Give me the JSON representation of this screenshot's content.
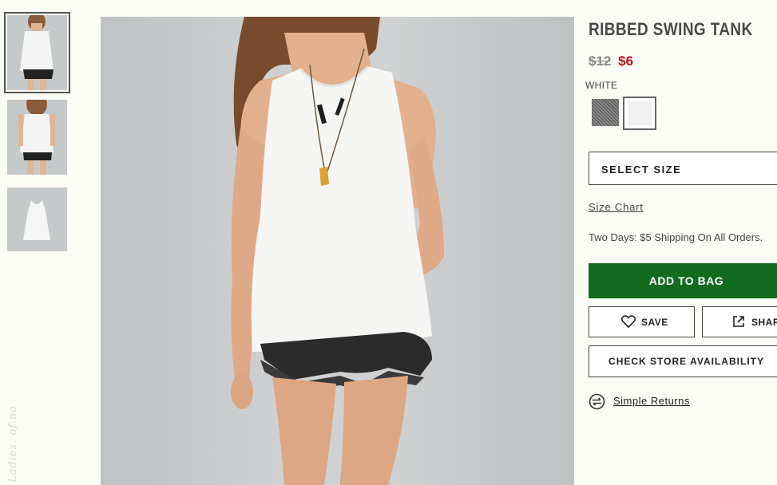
{
  "product": {
    "title": "RIBBED SWING TANK",
    "original_price": "$12",
    "sale_price": "$6",
    "color_name": "WHITE",
    "swatches": [
      "grey-heather",
      "white"
    ],
    "selected_swatch": "white"
  },
  "actions": {
    "size_select_label": "SELECT SIZE",
    "size_chart_label": "Size Chart",
    "shipping_text": "Two Days: $5 Shipping On All Orders.",
    "add_to_bag_label": "ADD TO BAG",
    "save_label": "SAVE",
    "share_label": "SHARE",
    "store_label": "CHECK STORE AVAILABILITY",
    "returns_label": "Simple Returns"
  },
  "gallery": {
    "thumbnail_count": 3,
    "selected_index": 0,
    "watermark": "Ladies. of.no"
  },
  "icons": {
    "save": "heart-icon",
    "share": "share-icon",
    "returns": "returns-icon"
  },
  "colors": {
    "accent_green": "#136b20",
    "sale_red": "#c0151b",
    "background": "#fcfcf6"
  }
}
